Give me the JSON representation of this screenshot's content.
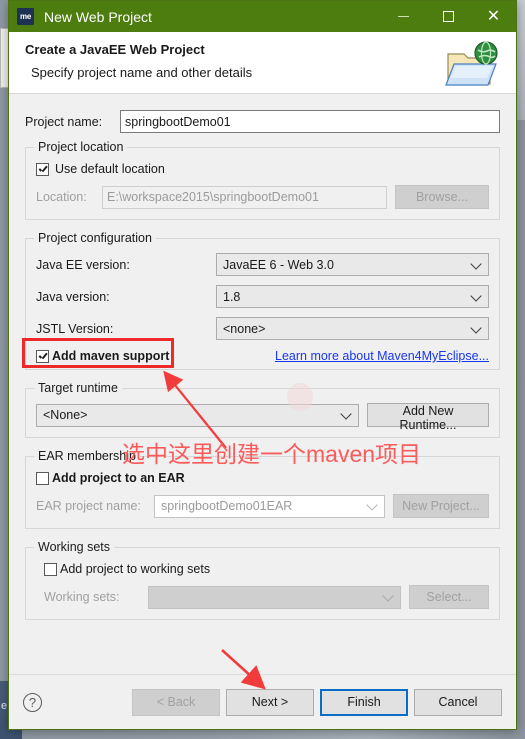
{
  "window": {
    "title": "New Web Project",
    "app_icon_text": "me",
    "controls": {
      "minimize": "minimize-icon",
      "maximize": "maximize-icon",
      "close": "close-icon"
    },
    "titlebar_color": "#4d7c0f"
  },
  "header": {
    "title": "Create a JavaEE Web Project",
    "subtitle": "Specify project name and other details",
    "icon": "folder-globe-icon"
  },
  "project_name": {
    "label": "Project name:",
    "value": "springbootDemo01"
  },
  "project_location": {
    "legend": "Project location",
    "use_default_label": "Use default location",
    "use_default_checked": true,
    "location_label": "Location:",
    "location_value": "E:\\workspace2015\\springbootDemo01",
    "browse_label": "Browse...",
    "browse_disabled": true
  },
  "project_configuration": {
    "legend": "Project configuration",
    "rows": [
      {
        "label": "Java EE version:",
        "value": "JavaEE 6 - Web 3.0"
      },
      {
        "label": "Java version:",
        "value": "1.8"
      },
      {
        "label": "JSTL Version:",
        "value": "<none>"
      }
    ],
    "maven_label": "Add maven support",
    "maven_checked": true,
    "learn_more_label": "Learn more about Maven4MyEclipse...",
    "highlight_color": "#ef2929"
  },
  "target_runtime": {
    "legend": "Target runtime",
    "value": "<None>",
    "add_button_label": "Add New Runtime..."
  },
  "ear_membership": {
    "legend": "EAR membership",
    "add_to_ear_label": "Add project to an EAR",
    "add_to_ear_checked": false,
    "ear_name_label": "EAR project name:",
    "ear_name_value": "springbootDemo01EAR",
    "new_project_label": "New Project...",
    "new_project_disabled": true
  },
  "working_sets": {
    "legend": "Working sets",
    "add_label": "Add project to working sets",
    "add_checked": false,
    "sets_label": "Working sets:",
    "sets_value": "",
    "select_label": "Select...",
    "select_disabled": true
  },
  "footer": {
    "help_label": "?",
    "back_label": "< Back",
    "back_disabled": true,
    "next_label": "Next >",
    "finish_label": "Finish",
    "finish_default": true,
    "cancel_label": "Cancel"
  },
  "annotations": {
    "note_text": "选中这里创建一个maven项目",
    "note_color": "#fb5b5b",
    "arrow_to_maven": "arrow-icon",
    "arrow_to_next": "arrow-icon"
  },
  "desktop": {
    "taskbar_label": "e"
  }
}
